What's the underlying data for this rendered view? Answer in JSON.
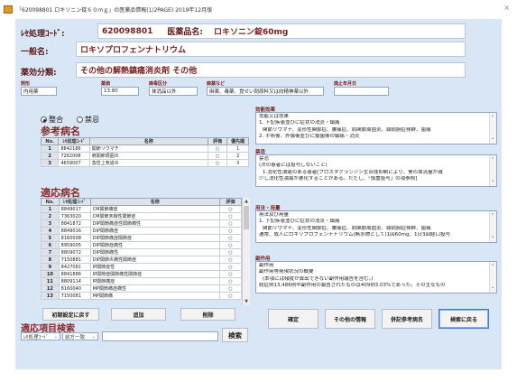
{
  "window": {
    "title": "「620098801 ロキソニン錠６０ｍｇ」の医薬品情報(1/2PAGE) 2019年12月版",
    "close": "×"
  },
  "header": {
    "code_label": "ﾚｾ処理ｺｰﾄﾞ:",
    "code_value": "620098801",
    "drug_name_label": "医薬品名:",
    "drug_name_value": "ロキソニン錠60mg",
    "generic_label": "一般名:",
    "generic_value": "ロキソプロフェンナトリウム",
    "category_label": "薬効分類:",
    "category_value": "その他の解熱鎮痛消炎剤 その他"
  },
  "attributes": {
    "type_label": "剤形",
    "type_value": "内用薬",
    "price_label": "薬価",
    "price_value": "13.80",
    "drug_class_label": "麻毒区分",
    "drug_class_value": "抹消品以外",
    "narcotic_label": "麻薬など",
    "narcotic_value": "麻薬、毒薬、覚せい剤原料又は向精神薬以外",
    "abolish_label": "廃止年月日",
    "abolish_value": ""
  },
  "radios": {
    "consistent": "整合",
    "contraindicated": "禁忌"
  },
  "reference": {
    "title": "参考病名",
    "columns": [
      "No.",
      "ﾚｾ処理ｺｰﾄﾞ",
      "名称",
      "評価",
      "優先順"
    ],
    "rows": [
      [
        "1",
        "8842186",
        "関節リウマチ",
        "○",
        "1"
      ],
      [
        "2",
        "7262008",
        "肩関節周囲炎",
        "○",
        "2"
      ],
      [
        "3",
        "4659007",
        "急性上気道炎",
        "○",
        "3"
      ]
    ]
  },
  "adapted": {
    "title": "適応病名",
    "columns": [
      "No.",
      "ﾚｾ処理ｺｰﾄﾞ",
      "名称",
      "評価"
    ],
    "rows": [
      [
        "1",
        "8849017",
        "CM関節痛症",
        "○"
      ],
      [
        "2",
        "7363020",
        "CM関節末梢性関節症",
        "○"
      ],
      [
        "3",
        "8841872",
        "DIP関節痛症性関節痛性",
        "○"
      ],
      [
        "4",
        "8849016",
        "DIP関節痛症",
        "○"
      ],
      [
        "5",
        "8160008",
        "DIP関節痛症関節症",
        "○"
      ],
      [
        "6",
        "8959005",
        "DIP関節症痛性",
        "○"
      ],
      [
        "7",
        "8809072",
        "DIP関節痛性",
        "○"
      ],
      [
        "8",
        "7150881",
        "DIP関節炎痛性関節症",
        "○"
      ],
      [
        "9",
        "8427081",
        "IP関節症性",
        "○"
      ],
      [
        "10",
        "8841886",
        "IP関節症関節痛性関節症",
        "○"
      ],
      [
        "11",
        "8809114",
        "IP関節痛症",
        "○"
      ],
      [
        "12",
        "8160040",
        "MP関節痛症痛性",
        "○"
      ],
      [
        "13",
        "7150081",
        "MP関節痛",
        "○"
      ]
    ]
  },
  "buttons": {
    "reset": "初期設定に戻す",
    "add": "追加",
    "delete": "削除",
    "search": "検索",
    "confirm": "確定",
    "other_info": "その他の情報",
    "ref_disease": "併記参考病名",
    "back": "検索に戻る"
  },
  "search": {
    "title": "適応項目検索",
    "combo1": "ﾚｾ処理ｺｰﾄﾞ",
    "combo2": "前方一致",
    "input": ""
  },
  "info": {
    "effect": {
      "label": "効能効果",
      "lines": [
        "効能又は効果",
        "1. 下記疾患並びに症状の消炎・鎮痛",
        "関節リウマチ、変形性関節症、腰痛症、肩関節周囲炎、頸肩腕症候群、歯痛",
        "2. 手術後、外傷後並びに抜歯後の鎮痛・消炎"
      ]
    },
    "contra": {
      "label": "禁忌",
      "lines": [
        "禁忌",
        "(次の患者には投与しないこと)",
        "1.消化性潰瘍のある患者[プロスタグランジン生合成抑制により、胃の血流量が減",
        "少し消化性潰瘍が悪化することがある。ただし、「慎重投与」の項参照]"
      ]
    },
    "dosage": {
      "label": "用法・用量",
      "lines": [
        "用法及び用量",
        "1. 下記疾患並びに症状の消炎・鎮痛",
        "関節リウマチ、変形性関節症、腰痛症、肩関節周囲炎、頸肩腕症候群、歯痛",
        "通常、成人にロキソプロフェンナトリウム(無水物として)1回60mg、1日3回経口投与"
      ]
    },
    "side": {
      "label": "副作用",
      "lines": [
        "副作用",
        "副作用等発現状況の概要",
        "(本項には頻度が算出できない副作用報告を含む。)",
        "総症例13,486例中副作用の報告されたものは409例3.03%であった。その主なもの"
      ]
    }
  }
}
